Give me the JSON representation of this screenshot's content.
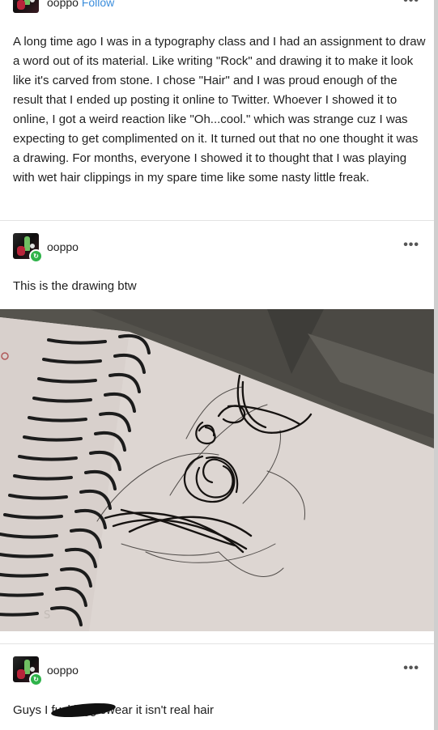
{
  "posts": [
    {
      "username": "ooppo",
      "follow_label": "Follow",
      "more_label": "•••",
      "text": "A long time ago I was in a typography class and I had an assignment to draw a word out of its material. Like writing \"Rock\" and drawing it to make it look like it's carved from stone. I chose \"Hair\" and I was proud enough of the result that I ended up posting it online to Twitter. Whoever I showed it to online, I got a weird reaction like \"Oh...cool.\" which was strange cuz I was expecting to get complimented on it. It turned out that no one thought it was a drawing. For months, everyone I showed it to thought that I was playing with wet hair clippings in my spare time like some nasty little freak."
    },
    {
      "username": "ooppo",
      "more_label": "•••",
      "text": "This is the drawing btw",
      "image_alt": "hair drawing on sketchbook page"
    },
    {
      "username": "ooppo",
      "more_label": "•••",
      "text_pre": "Guys I f",
      "text_redacted": "ucking",
      "text_post": "g swear it isn't real hair"
    }
  ],
  "colors": {
    "follow": "#3b8ddc",
    "badge": "#2fb34a",
    "divider": "#e3e3e3"
  },
  "icons": {
    "badge": "reblog-badge-icon",
    "more": "more-options-icon"
  }
}
